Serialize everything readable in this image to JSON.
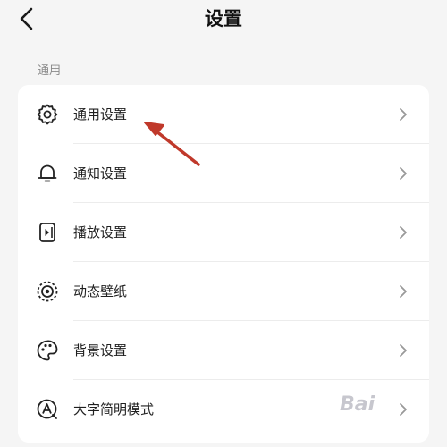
{
  "header": {
    "title": "设置",
    "back_icon": "chevron-left-icon"
  },
  "section": {
    "label": "通用"
  },
  "items": [
    {
      "label": "通用设置",
      "icon": "gear-icon"
    },
    {
      "label": "通知设置",
      "icon": "bell-icon"
    },
    {
      "label": "播放设置",
      "icon": "play-device-icon"
    },
    {
      "label": "动态壁纸",
      "icon": "live-wallpaper-icon"
    },
    {
      "label": "背景设置",
      "icon": "palette-icon"
    },
    {
      "label": "大字简明模式",
      "icon": "large-font-icon"
    }
  ],
  "watermark": {
    "text": "Bai"
  },
  "colors": {
    "background": "#f5f5f5",
    "card": "#ffffff",
    "annotation": "#c0392b"
  }
}
